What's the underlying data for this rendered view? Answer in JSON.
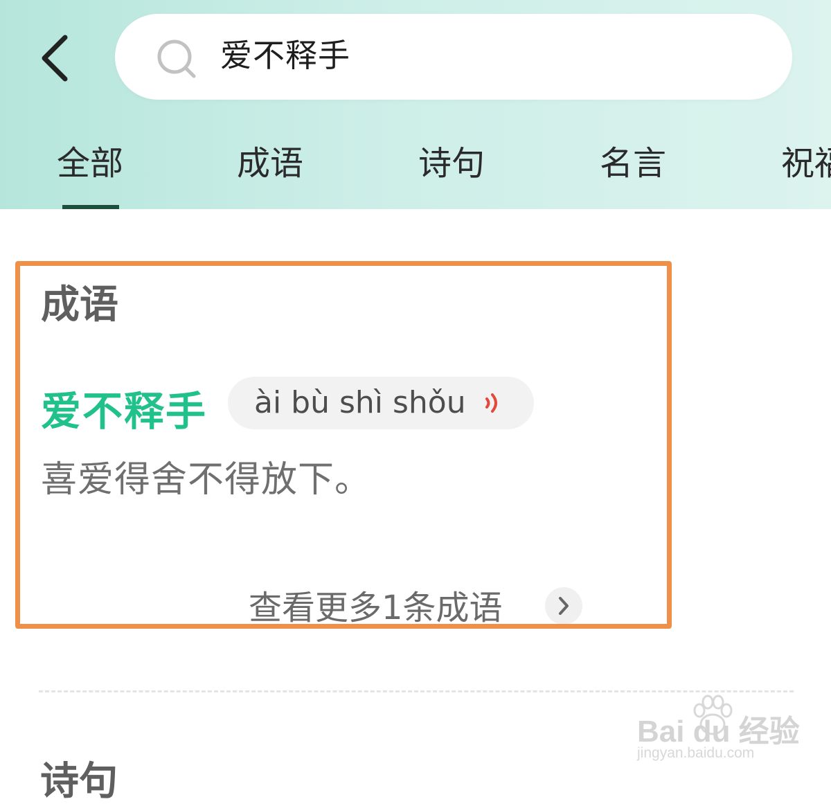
{
  "search": {
    "query": "爱不释手"
  },
  "tabs": [
    {
      "label": "全部",
      "active": true
    },
    {
      "label": "成语",
      "active": false
    },
    {
      "label": "诗句",
      "active": false
    },
    {
      "label": "名言",
      "active": false
    },
    {
      "label": "祝福",
      "active": false
    }
  ],
  "idiom_card": {
    "section_title": "成语",
    "word": "爱不释手",
    "pinyin": "ài bù shì shǒu",
    "meaning": "喜爱得舍不得放下。",
    "more_link": "查看更多1条成语"
  },
  "next_section": {
    "title": "诗句"
  },
  "watermark": {
    "logo_text": "Bai du 经验",
    "url": "jingyan.baidu.com"
  },
  "colors": {
    "accent_green": "#21c18b",
    "tab_indicator": "#1d4f3f",
    "highlight_box": "#ee9048",
    "sound_icon": "#e4473b",
    "header_gradient_start": "#b5e6dc",
    "header_gradient_end": "#dcf3ee"
  },
  "icons": [
    "back-arrow-icon",
    "search-icon",
    "sound-icon",
    "chevron-right-icon",
    "baidu-paw-icon"
  ]
}
